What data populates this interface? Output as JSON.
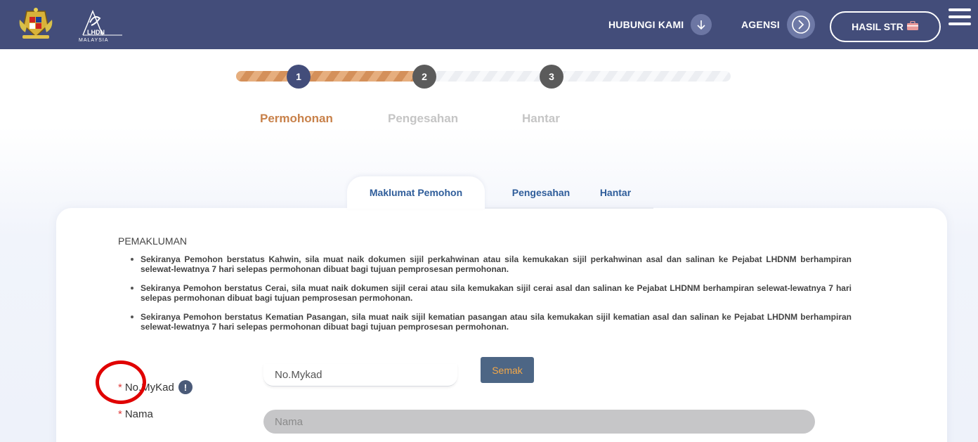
{
  "header": {
    "logo_text": "LHDN",
    "logo_subtext": "MALAYSIA",
    "nav_contact": "HUBUNGI KAMI",
    "nav_agency": "AGENSI",
    "hasil_btn": "HASIL STR",
    "contact_icon": "arrow-down-icon",
    "agency_icon": "chevron-right-icon",
    "hasil_icon": "briefcase-icon",
    "menu_icon": "hamburger-icon"
  },
  "stepper": {
    "progress_fraction": 0.37,
    "steps": [
      {
        "number": "1",
        "label": "Permohonan",
        "state": "active"
      },
      {
        "number": "2",
        "label": "Pengesahan",
        "state": "inactive"
      },
      {
        "number": "3",
        "label": "Hantar",
        "state": "inactive"
      }
    ]
  },
  "tabs": [
    {
      "label": "Maklumat Pemohon",
      "active": true
    },
    {
      "label": "Pengesahan",
      "active": false
    },
    {
      "label": "Hantar",
      "active": false
    }
  ],
  "notice": {
    "title": "PEMAKLUMAN",
    "items": [
      "Sekiranya Pemohon berstatus Kahwin, sila muat naik dokumen sijil perkahwinan atau sila kemukakan sijil perkahwinan asal dan salinan ke Pejabat LHDNM berhampiran selewat-lewatnya 7 hari selepas permohonan dibuat bagi tujuan pemprosesan permohonan.",
      "Sekiranya Pemohon berstatus Cerai, sila muat naik dokumen sijil cerai atau sila kemukakan sijil cerai asal dan salinan ke Pejabat LHDNM berhampiran selewat-lewatnya 7 hari selepas permohonan dibuat bagi tujuan pemprosesan permohonan.",
      "Sekiranya Pemohon berstatus Kematian Pasangan, sila muat naik sijil kematian pasangan atau sila kemukakan sijil kematian asal dan salinan ke Pejabat LHDNM berhampiran selewat-lewatnya 7 hari selepas permohonan dibuat bagi tujuan pemprosesan permohonan."
    ]
  },
  "form": {
    "required_mark": "*",
    "mykad_label": "No.MyKad",
    "mykad_placeholder": "No.Mykad",
    "mykad_value": "",
    "info_icon": "info-icon",
    "info_glyph": "!",
    "semak_label": "Semak",
    "nama_label": "Nama",
    "nama_placeholder": "Nama"
  },
  "colors": {
    "header_bg": "#434d7a",
    "accent_orange": "#c8814a",
    "tab_text": "#2f5d9a",
    "button_bg": "#4d6685",
    "button_text": "#f4a848",
    "annotation_red": "#e00000"
  }
}
